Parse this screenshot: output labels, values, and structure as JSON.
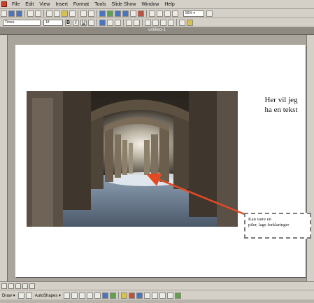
{
  "menu": {
    "items": [
      "File",
      "Edit",
      "View",
      "Insert",
      "Format",
      "Tools",
      "Slide Show",
      "Window",
      "Help"
    ]
  },
  "toolbar": {
    "zoom_value": "55% ▾",
    "font_value": "Times",
    "size_value": "18"
  },
  "document": {
    "title": "untitled-1"
  },
  "slide": {
    "textbox_top": {
      "line1": "Her vil jeg",
      "line2": "ha en tekst"
    },
    "textbox_bottom": {
      "line1": "Kan være en",
      "line2": "piler, lage forklaringer"
    }
  },
  "drawing_toolbar": {
    "draw_label": "Draw ▾",
    "autoshapes_label": "AutoShapes ▾"
  },
  "colors": {
    "arrow": "#e34a22",
    "chrome": "#d4d0c8",
    "workspace": "#a9a59c"
  },
  "icons": [
    "app-icon",
    "new-icon",
    "open-icon",
    "save-icon",
    "print-icon",
    "bold-icon",
    "italic-icon",
    "underline-icon",
    "align-icon",
    "arrow-icon",
    "rectangle-icon",
    "oval-icon",
    "textbox-icon",
    "fill-color-icon",
    "line-color-icon",
    "font-color-icon"
  ]
}
